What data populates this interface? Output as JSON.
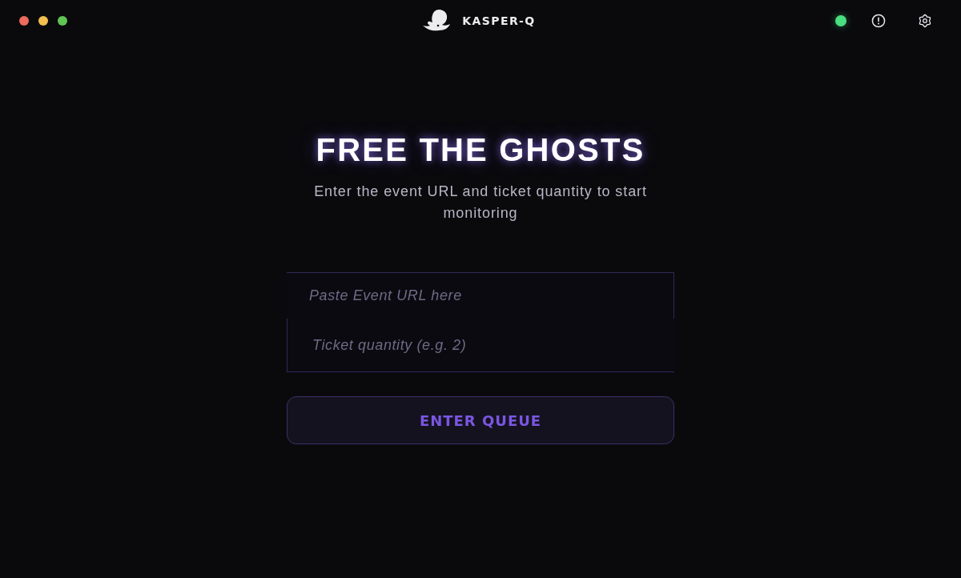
{
  "window": {
    "app_name": "KASPER-Q"
  },
  "toolbar": {
    "connected": true
  },
  "hero": {
    "title": "FREE THE GHOSTS",
    "subtitle": "Enter the event URL and ticket quantity to start monitoring"
  },
  "form": {
    "fields": [
      {
        "placeholder": "Paste Event URL here"
      },
      {
        "placeholder": "Ticket quantity (e.g. 2)"
      }
    ],
    "submit": "ENTER QUEUE"
  }
}
